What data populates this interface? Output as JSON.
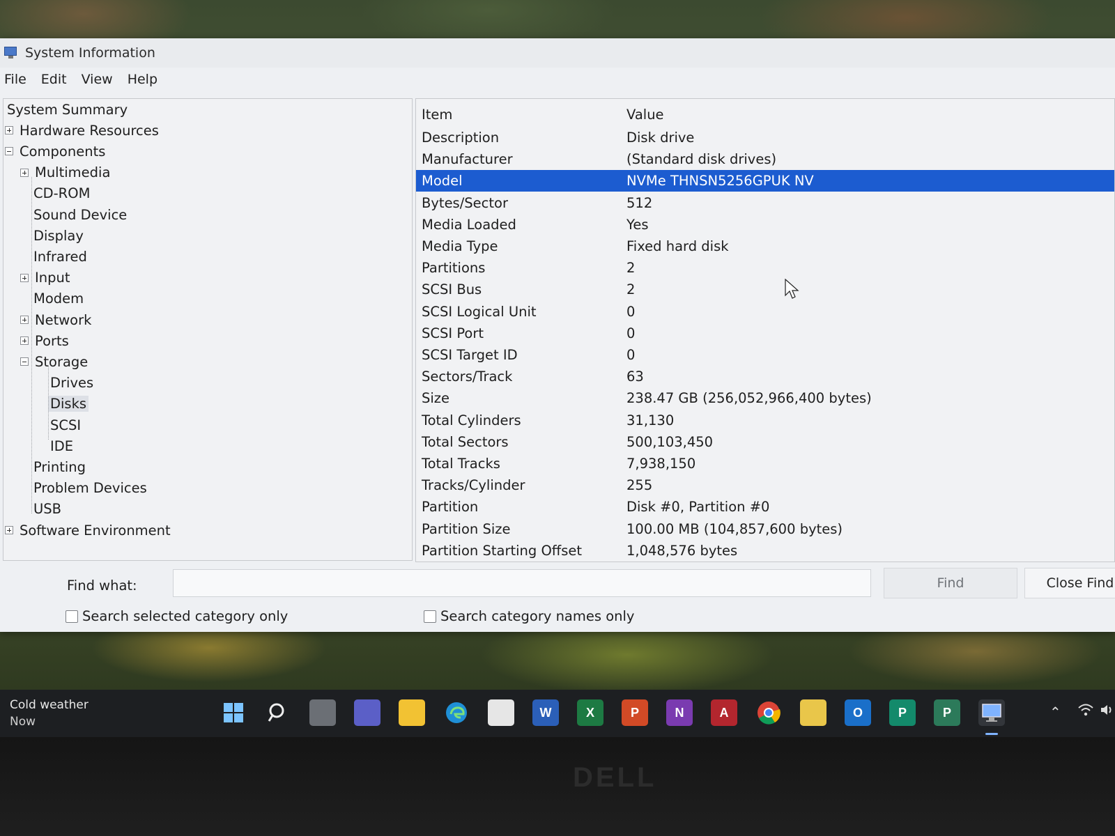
{
  "window": {
    "title": "System Information",
    "menu": [
      "File",
      "Edit",
      "View",
      "Help"
    ]
  },
  "tree": {
    "nodes": [
      {
        "label": "System Summary",
        "expander": "",
        "level": 0
      },
      {
        "label": "Hardware Resources",
        "expander": "plus",
        "level": 0
      },
      {
        "label": "Components",
        "expander": "minus",
        "level": 0
      },
      {
        "label": "Multimedia",
        "expander": "plus",
        "level": 1
      },
      {
        "label": "CD-ROM",
        "expander": "",
        "level": 1
      },
      {
        "label": "Sound Device",
        "expander": "",
        "level": 1
      },
      {
        "label": "Display",
        "expander": "",
        "level": 1
      },
      {
        "label": "Infrared",
        "expander": "",
        "level": 1
      },
      {
        "label": "Input",
        "expander": "plus",
        "level": 1
      },
      {
        "label": "Modem",
        "expander": "",
        "level": 1
      },
      {
        "label": "Network",
        "expander": "plus",
        "level": 1
      },
      {
        "label": "Ports",
        "expander": "plus",
        "level": 1
      },
      {
        "label": "Storage",
        "expander": "minus",
        "level": 1
      },
      {
        "label": "Drives",
        "expander": "",
        "level": 2
      },
      {
        "label": "Disks",
        "expander": "",
        "level": 2,
        "selected": true
      },
      {
        "label": "SCSI",
        "expander": "",
        "level": 2
      },
      {
        "label": "IDE",
        "expander": "",
        "level": 2
      },
      {
        "label": "Printing",
        "expander": "",
        "level": 1
      },
      {
        "label": "Problem Devices",
        "expander": "",
        "level": 1
      },
      {
        "label": "USB",
        "expander": "",
        "level": 1
      },
      {
        "label": "Software Environment",
        "expander": "plus",
        "level": 0
      }
    ]
  },
  "table": {
    "headers": {
      "item": "Item",
      "value": "Value"
    },
    "rows": [
      {
        "item": "Description",
        "value": "Disk drive"
      },
      {
        "item": "Manufacturer",
        "value": "(Standard disk drives)"
      },
      {
        "item": "Model",
        "value": "NVMe THNSN5256GPUK NV",
        "selected": true
      },
      {
        "item": "Bytes/Sector",
        "value": "512"
      },
      {
        "item": "Media Loaded",
        "value": "Yes"
      },
      {
        "item": "Media Type",
        "value": "Fixed hard disk"
      },
      {
        "item": "Partitions",
        "value": "2"
      },
      {
        "item": "SCSI Bus",
        "value": "2"
      },
      {
        "item": "SCSI Logical Unit",
        "value": "0"
      },
      {
        "item": "SCSI Port",
        "value": "0"
      },
      {
        "item": "SCSI Target ID",
        "value": "0"
      },
      {
        "item": "Sectors/Track",
        "value": "63"
      },
      {
        "item": "Size",
        "value": "238.47 GB (256,052,966,400 bytes)"
      },
      {
        "item": "Total Cylinders",
        "value": "31,130"
      },
      {
        "item": "Total Sectors",
        "value": "500,103,450"
      },
      {
        "item": "Total Tracks",
        "value": "7,938,150"
      },
      {
        "item": "Tracks/Cylinder",
        "value": "255"
      },
      {
        "item": "Partition",
        "value": "Disk #0, Partition #0"
      },
      {
        "item": "Partition Size",
        "value": "100.00 MB (104,857,600 bytes)"
      },
      {
        "item": "Partition Starting Offset",
        "value": "1,048,576 bytes"
      }
    ]
  },
  "find": {
    "label": "Find what:",
    "value": "",
    "find_button": "Find",
    "close_button": "Close Find",
    "check_selected": "Search selected category only",
    "check_names": "Search category names only"
  },
  "taskbar": {
    "weather_title": "Cold weather",
    "weather_sub": "Now",
    "apps": [
      {
        "name": "start-icon",
        "glyph": "",
        "color": "#3a8ee6"
      },
      {
        "name": "search-icon",
        "glyph": "",
        "color": "transparent"
      },
      {
        "name": "task-view-icon",
        "glyph": "",
        "color": "#6b6f75"
      },
      {
        "name": "teams-chat-icon",
        "glyph": "",
        "color": "#5b5fc7"
      },
      {
        "name": "file-explorer-icon",
        "glyph": "",
        "color": "#f2c233"
      },
      {
        "name": "edge-icon",
        "glyph": "",
        "color": "#1f8fd6"
      },
      {
        "name": "store-icon",
        "glyph": "",
        "color": "#e6e6e6"
      },
      {
        "name": "word-icon",
        "glyph": "W",
        "color": "#2b5fb8"
      },
      {
        "name": "excel-icon",
        "glyph": "X",
        "color": "#1d7a43"
      },
      {
        "name": "powerpoint-icon",
        "glyph": "P",
        "color": "#d24a26"
      },
      {
        "name": "onenote-icon",
        "glyph": "N",
        "color": "#7a3bb0"
      },
      {
        "name": "access-icon",
        "glyph": "A",
        "color": "#b3262e"
      },
      {
        "name": "chrome-icon",
        "glyph": "",
        "color": "#2a8b3c"
      },
      {
        "name": "files-icon",
        "glyph": "",
        "color": "#e9c64a"
      },
      {
        "name": "outlook-icon",
        "glyph": "O",
        "color": "#1a6fc9"
      },
      {
        "name": "publisher-icon",
        "glyph": "P",
        "color": "#138a6b"
      },
      {
        "name": "project-icon",
        "glyph": "P",
        "color": "#2c7a5a"
      },
      {
        "name": "system-information-icon",
        "glyph": "",
        "color": "#5b85c9"
      }
    ]
  },
  "bezel": {
    "brand": "DELL"
  }
}
